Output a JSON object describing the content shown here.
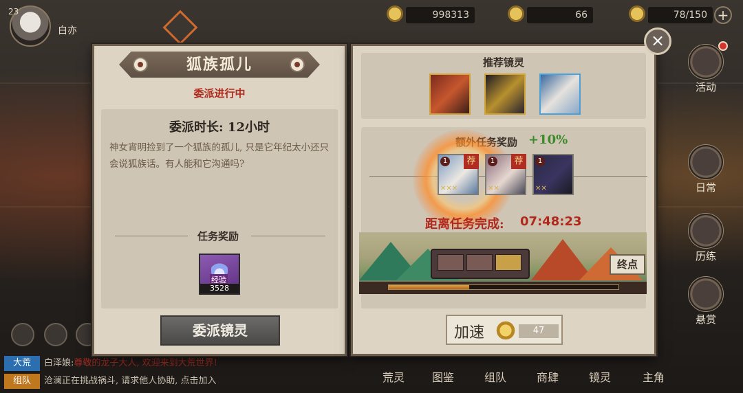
{
  "player": {
    "level": "23",
    "name": "白亦"
  },
  "resources": {
    "coins": "998313",
    "jade": "66",
    "stamina": "78/150",
    "plus_label": "+"
  },
  "side_menu": [
    {
      "label": "活动",
      "icon": "activity-icon"
    },
    {
      "label": "日常",
      "icon": "daily-icon"
    },
    {
      "label": "历练",
      "icon": "training-icon"
    },
    {
      "label": "悬赏",
      "icon": "bounty-icon"
    }
  ],
  "bottom_nav": [
    "荒灵",
    "图鉴",
    "组队",
    "商肆",
    "镜灵",
    "主角"
  ],
  "chat": [
    {
      "tag": "大荒",
      "tag_color": "#2b6fb0",
      "speaker": "白泽娘:",
      "text": "尊敬的龙子大人, 欢迎来到大荒世界!"
    },
    {
      "tag": "组队",
      "tag_color": "#c0781e",
      "speaker": "",
      "text": "沧澜正在挑战祸斗, 请求他人协助, 点击加入"
    }
  ],
  "left_panel": {
    "title": "狐族孤儿",
    "status": "委派进行中",
    "duration": "委派时长: 12小时",
    "description": "神女宵明捡到了一个狐族的孤儿, 只是它年纪太小还只会说狐族话。有人能和它沟通吗?",
    "reward_header": "任务奖励",
    "reward": {
      "label": "经验",
      "count": "3528"
    },
    "dispatch_button": "委派镜灵"
  },
  "right_panel": {
    "recommend_title": "推荐镜灵",
    "bonus_label": "额外任务奖励",
    "bonus_value": "+10%",
    "slot_tag": "荐",
    "slot_level": "1",
    "timer_label": "距离任务完成:",
    "timer_value": "07:48:23",
    "end_label": "终点",
    "progress": 0.35,
    "speedup_label": "加速",
    "speedup_cost": "47"
  },
  "close_label": "×",
  "colors": {
    "status_red": "#b02b1e",
    "bonus_green": "#3c8a2a",
    "accent_orange": "#d16a2f"
  }
}
